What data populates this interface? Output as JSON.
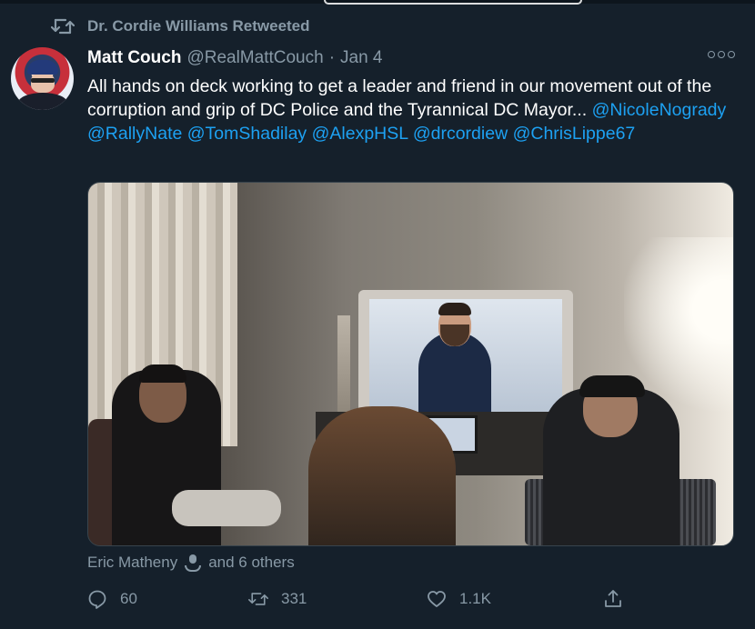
{
  "retweet_context": {
    "text": "Dr. Cordie Williams Retweeted",
    "icon": "retweet-icon"
  },
  "tweet": {
    "author_name": "Matt Couch",
    "author_handle": "@RealMattCouch",
    "separator": "·",
    "date": "Jan 4",
    "text_plain": "All hands on deck working to get a leader and friend in our movement out of the corruption and grip of DC Police and the Tyrannical DC Mayor... ",
    "mentions": [
      "@NicoleNogrady",
      "@RallyNate",
      "@TomShadilay",
      "@AlexpHSL",
      "@drcordiew",
      "@ChrisLippe67"
    ],
    "tagged_user": "Eric Matheny",
    "tagged_others": "and 6 others"
  },
  "actions": {
    "reply_count": "60",
    "retweet_count": "331",
    "like_count": "1.1K"
  },
  "colors": {
    "background": "#15202b",
    "text": "#ffffff",
    "muted": "#8899a6",
    "link": "#1da1f2",
    "border": "#38444d"
  },
  "icons": [
    "retweet-icon",
    "more-icon",
    "reply-icon",
    "like-icon",
    "share-icon",
    "user-icon"
  ]
}
